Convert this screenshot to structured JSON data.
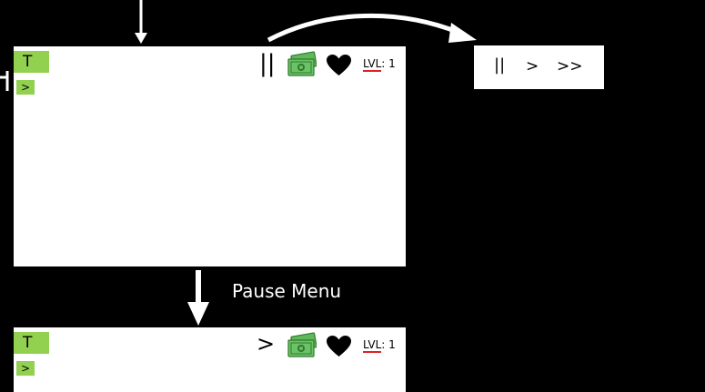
{
  "top_screen": {
    "tab_letter": "T",
    "tab_arrow": ">",
    "control_symbol": "||",
    "lvl_label": "LVL",
    "lvl_value": ": 1"
  },
  "speed_menu": {
    "pause": "||",
    "play": ">",
    "fast_forward": ">>"
  },
  "caption": "Pause Menu",
  "bottom_screen": {
    "tab_letter": "T",
    "tab_arrow": ">",
    "control_symbol": ">",
    "lvl_label": "LVL",
    "lvl_value": ": 1"
  },
  "icons": {
    "money": "money-icon",
    "heart": "heart-icon"
  },
  "colors": {
    "tab_green": "#92d050",
    "money_green": "#5fb85a",
    "underline_red": "#e02020"
  }
}
